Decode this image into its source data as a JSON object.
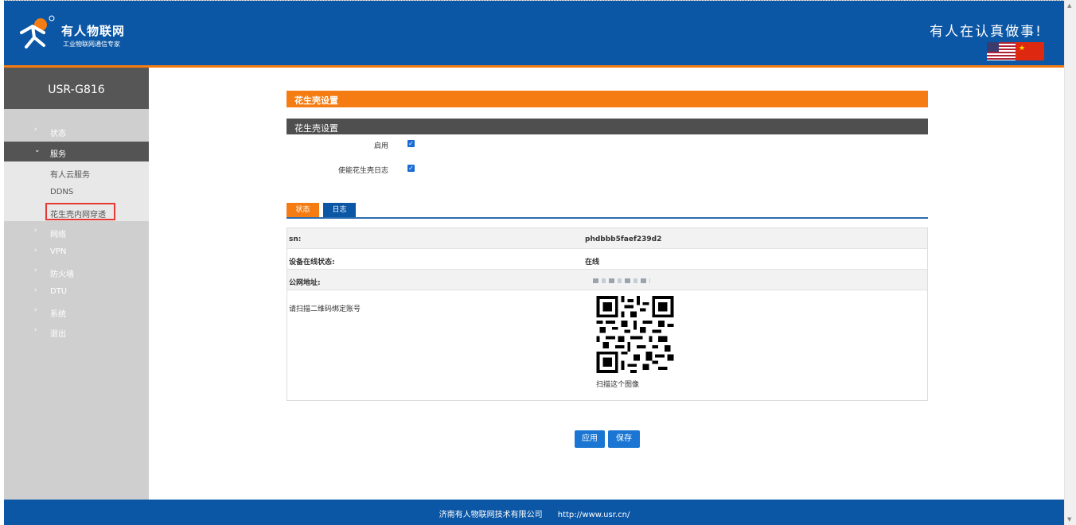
{
  "header": {
    "brand": "有人物联网",
    "tagline": "工业物联网通信专家",
    "slogan": "有人在认真做事!"
  },
  "sidebar": {
    "model": "USR-G816",
    "items": [
      {
        "label": "状态",
        "chevron": "›"
      },
      {
        "label": "服务",
        "chevron": "⌄"
      },
      {
        "label": "网络",
        "chevron": "›"
      },
      {
        "label": "VPN",
        "chevron": "›"
      },
      {
        "label": "防火墙",
        "chevron": "›"
      },
      {
        "label": "DTU",
        "chevron": "›"
      },
      {
        "label": "系统",
        "chevron": "›"
      },
      {
        "label": "退出",
        "chevron": "›"
      }
    ],
    "subitems": [
      {
        "label": "有人云服务"
      },
      {
        "label": "DDNS"
      },
      {
        "label": "花生壳内网穿透"
      }
    ]
  },
  "main": {
    "page_title": "花生壳设置",
    "section_title": "花生壳设置",
    "enable_label": "启用",
    "enable_checked": true,
    "log_label": "使能花生壳日志",
    "log_checked": true,
    "tabs": [
      {
        "label": "状态"
      },
      {
        "label": "日志"
      }
    ],
    "status": {
      "sn_key": "sn:",
      "sn_value": "phdbbb5faef239d2",
      "online_key": "设备在线状态:",
      "online_value": "在线",
      "ip_key": "公网地址:",
      "qr_key": "请扫描二维码绑定账号",
      "qr_caption": "扫描这个图像"
    },
    "apply_label": "应用",
    "save_label": "保存"
  },
  "footer": {
    "company": "济南有人物联网技术有限公司",
    "url": "http://www.usr.cn/"
  },
  "colors": {
    "header_blue": "#0b57a5",
    "accent_orange": "#f57c12",
    "button_blue": "#1a76d2",
    "sidebar_gray": "#cfcfcf",
    "active_gray": "#545454"
  }
}
